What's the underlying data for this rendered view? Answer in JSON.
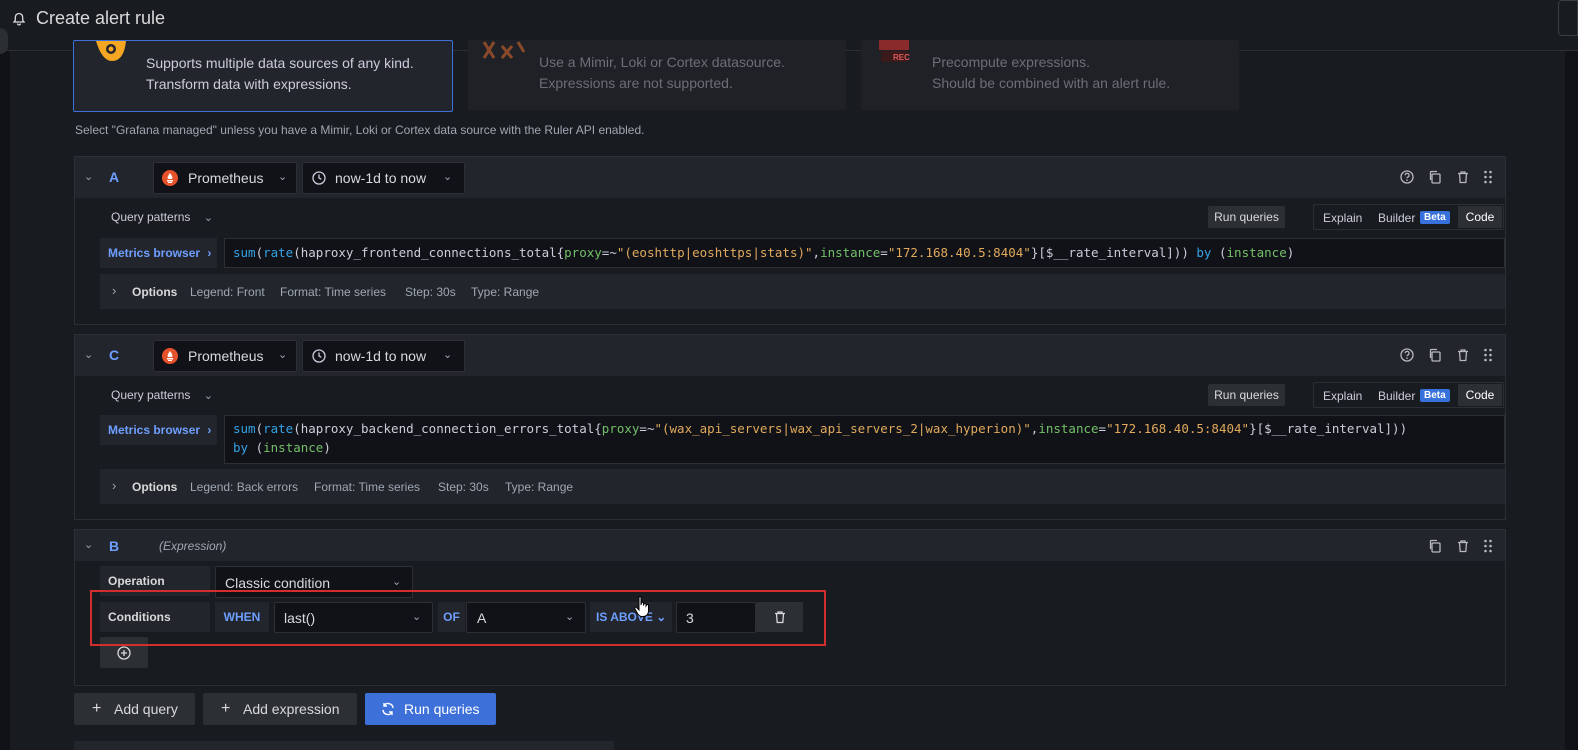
{
  "header": {
    "title": "Create alert rule"
  },
  "rule_types": [
    {
      "line1": "Supports multiple data sources of any kind.",
      "line2": "Transform data with expressions."
    },
    {
      "line1": "Use a Mimir, Loki or Cortex datasource.",
      "line2": "Expressions are not supported."
    },
    {
      "line1": "Precompute expressions.",
      "line2": "Should be combined with an alert rule."
    }
  ],
  "rule_type_badge": "REC",
  "rule_hint": "Select \"Grafana managed\" unless you have a Mimir, Loki or Cortex data source with the Ruler API enabled.",
  "queries": [
    {
      "letter": "A",
      "datasource": "Prometheus",
      "time_range": "now-1d to now",
      "query_patterns": "Query patterns",
      "run_queries": "Run queries",
      "modes": {
        "explain": "Explain",
        "builder": "Builder",
        "beta": "Beta",
        "code": "Code"
      },
      "metrics_browser": "Metrics browser",
      "code": {
        "fn1": "sum",
        "fn2": "rate",
        "metric": "haproxy_frontend_connections_total",
        "label1": "proxy",
        "op1": "=~",
        "val1": "\"(eoshttp|eoshttps|stats)\"",
        "label2": "instance",
        "op2": "=",
        "val2": "\"172.168.40.5:8404\"",
        "range": "[$__rate_interval]))",
        "by": "by",
        "by_label": "instance"
      },
      "options": {
        "label": "Options",
        "legend": "Legend: Front",
        "format": "Format: Time series",
        "step": "Step: 30s",
        "type": "Type: Range"
      }
    },
    {
      "letter": "C",
      "datasource": "Prometheus",
      "time_range": "now-1d to now",
      "query_patterns": "Query patterns",
      "run_queries": "Run queries",
      "modes": {
        "explain": "Explain",
        "builder": "Builder",
        "beta": "Beta",
        "code": "Code"
      },
      "metrics_browser": "Metrics browser",
      "code": {
        "fn1": "sum",
        "fn2": "rate",
        "metric": "haproxy_backend_connection_errors_total",
        "label1": "proxy",
        "op1": "=~",
        "val1": "\"(wax_api_servers|wax_api_servers_2|wax_hyperion)\"",
        "label2": "instance",
        "op2": "=",
        "val2": "\"172.168.40.5:8404\"",
        "range": "[$__rate_interval]))",
        "by": "by",
        "by_label": "instance"
      },
      "options": {
        "label": "Options",
        "legend": "Legend: Back errors",
        "format": "Format: Time series",
        "step": "Step: 30s",
        "type": "Type: Range"
      }
    }
  ],
  "expression": {
    "letter": "B",
    "type_label": "(Expression)",
    "operation_label": "Operation",
    "operation_value": "Classic condition",
    "conditions_label": "Conditions",
    "when": "WHEN",
    "reducer": "last()",
    "of": "OF",
    "query_ref": "A",
    "evaluator": "IS ABOVE",
    "threshold": "3"
  },
  "footer": {
    "add_query": "Add query",
    "add_expression": "Add expression",
    "run_queries": "Run queries"
  },
  "colors": {
    "accent": "#3d71d9",
    "highlight_box": "#d32d2d",
    "background": "#181b1f"
  }
}
